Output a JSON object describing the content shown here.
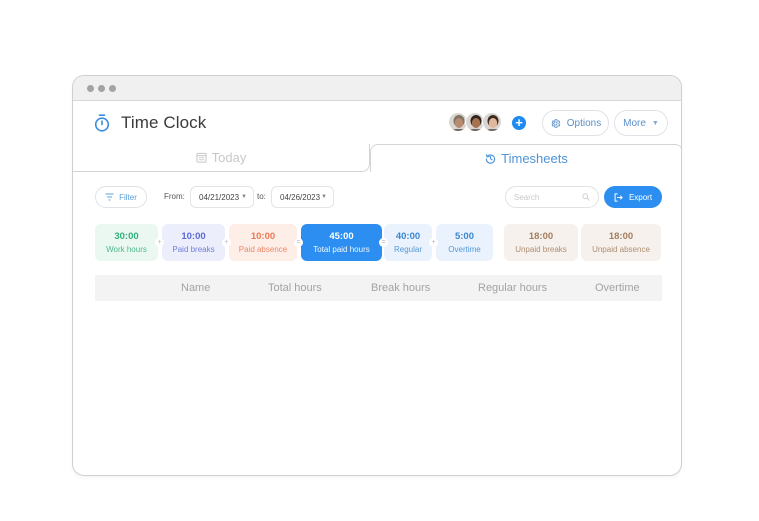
{
  "window": {
    "title": "Time Clock",
    "app_icon": "stopwatch-icon"
  },
  "header": {
    "avatars": [
      {
        "name": "team-member-1",
        "skin": "#b98a6f",
        "hair": "#7d7466"
      },
      {
        "name": "team-member-2",
        "skin": "#a8724f",
        "hair": "#2e2520"
      },
      {
        "name": "team-member-3",
        "skin": "#e0b79b",
        "hair": "#3c2a21"
      }
    ],
    "add_member_symbol": "+",
    "options_label": "Options",
    "more_label": "More",
    "caret": "▼"
  },
  "tabs": [
    {
      "label": "Today",
      "icon": "calendar-icon",
      "active": false
    },
    {
      "label": "Timesheets",
      "icon": "history-icon",
      "active": true
    }
  ],
  "toolbar": {
    "filter_label": "Filter",
    "from_label": "From:",
    "from_value": "04/21/2023",
    "to_label": "to:",
    "to_value": "04/26/2023",
    "search_placeholder": "Search",
    "export_label": "Export"
  },
  "summary_cards": [
    {
      "value": "30:00",
      "label": "Work hours",
      "bg": "#eaf8f1",
      "color": "#2fb07a",
      "op_after": "+"
    },
    {
      "value": "10:00",
      "label": "Paid breaks",
      "bg": "#eceefc",
      "color": "#5b6bd6",
      "op_after": "+"
    },
    {
      "value": "10:00",
      "label": "Paid absence",
      "bg": "#fdeee8",
      "color": "#ec7752",
      "op_after": "="
    },
    {
      "value": "45:00",
      "label": "Total paid hours",
      "bg": "#2b8ef0",
      "color": "#ffffff",
      "op_after": "="
    },
    {
      "value": "40:00",
      "label": "Regular",
      "bg": "#eaf3fd",
      "color": "#3a86d1",
      "op_after": "+"
    },
    {
      "value": "5:00",
      "label": "Overtime",
      "bg": "#eaf3fd",
      "color": "#3a86d1",
      "op_after": ""
    },
    {
      "value": "18:00",
      "label": "Unpaid breaks",
      "bg": "#f6f1ec",
      "color": "#a27d5e",
      "op_after": ""
    },
    {
      "value": "18:00",
      "label": "Unpaid absence",
      "bg": "#f6f1ec",
      "color": "#a27d5e",
      "op_after": ""
    }
  ],
  "table": {
    "columns": [
      "Name",
      "Total hours",
      "Break hours",
      "Regular hours",
      "Overtime"
    ],
    "rows": []
  },
  "colors": {
    "accent": "#2b8ef0",
    "tab_active": "#4f94d6",
    "tab_inactive": "#c8c8c8"
  }
}
